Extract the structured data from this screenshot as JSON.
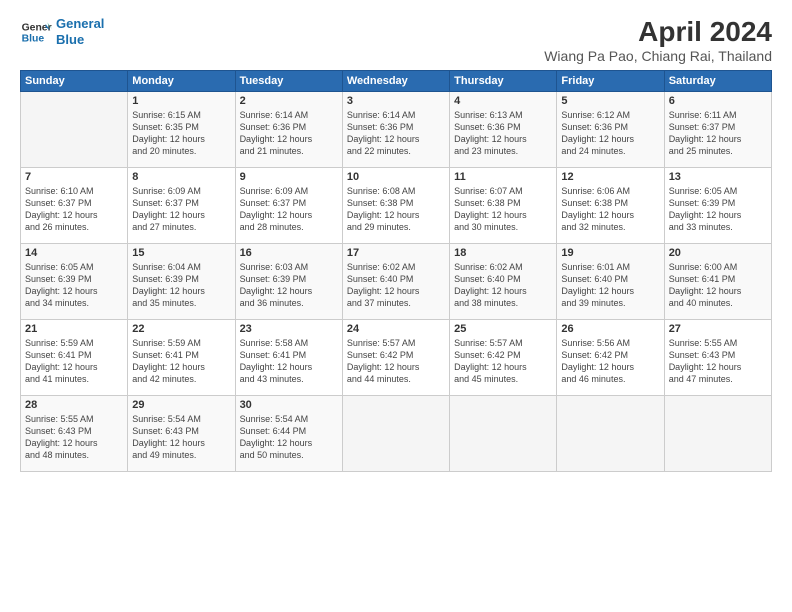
{
  "header": {
    "logo_line1": "General",
    "logo_line2": "Blue",
    "month": "April 2024",
    "location": "Wiang Pa Pao, Chiang Rai, Thailand"
  },
  "weekdays": [
    "Sunday",
    "Monday",
    "Tuesday",
    "Wednesday",
    "Thursday",
    "Friday",
    "Saturday"
  ],
  "weeks": [
    [
      {
        "day": "",
        "text": ""
      },
      {
        "day": "1",
        "text": "Sunrise: 6:15 AM\nSunset: 6:35 PM\nDaylight: 12 hours\nand 20 minutes."
      },
      {
        "day": "2",
        "text": "Sunrise: 6:14 AM\nSunset: 6:36 PM\nDaylight: 12 hours\nand 21 minutes."
      },
      {
        "day": "3",
        "text": "Sunrise: 6:14 AM\nSunset: 6:36 PM\nDaylight: 12 hours\nand 22 minutes."
      },
      {
        "day": "4",
        "text": "Sunrise: 6:13 AM\nSunset: 6:36 PM\nDaylight: 12 hours\nand 23 minutes."
      },
      {
        "day": "5",
        "text": "Sunrise: 6:12 AM\nSunset: 6:36 PM\nDaylight: 12 hours\nand 24 minutes."
      },
      {
        "day": "6",
        "text": "Sunrise: 6:11 AM\nSunset: 6:37 PM\nDaylight: 12 hours\nand 25 minutes."
      }
    ],
    [
      {
        "day": "7",
        "text": "Sunrise: 6:10 AM\nSunset: 6:37 PM\nDaylight: 12 hours\nand 26 minutes."
      },
      {
        "day": "8",
        "text": "Sunrise: 6:09 AM\nSunset: 6:37 PM\nDaylight: 12 hours\nand 27 minutes."
      },
      {
        "day": "9",
        "text": "Sunrise: 6:09 AM\nSunset: 6:37 PM\nDaylight: 12 hours\nand 28 minutes."
      },
      {
        "day": "10",
        "text": "Sunrise: 6:08 AM\nSunset: 6:38 PM\nDaylight: 12 hours\nand 29 minutes."
      },
      {
        "day": "11",
        "text": "Sunrise: 6:07 AM\nSunset: 6:38 PM\nDaylight: 12 hours\nand 30 minutes."
      },
      {
        "day": "12",
        "text": "Sunrise: 6:06 AM\nSunset: 6:38 PM\nDaylight: 12 hours\nand 32 minutes."
      },
      {
        "day": "13",
        "text": "Sunrise: 6:05 AM\nSunset: 6:39 PM\nDaylight: 12 hours\nand 33 minutes."
      }
    ],
    [
      {
        "day": "14",
        "text": "Sunrise: 6:05 AM\nSunset: 6:39 PM\nDaylight: 12 hours\nand 34 minutes."
      },
      {
        "day": "15",
        "text": "Sunrise: 6:04 AM\nSunset: 6:39 PM\nDaylight: 12 hours\nand 35 minutes."
      },
      {
        "day": "16",
        "text": "Sunrise: 6:03 AM\nSunset: 6:39 PM\nDaylight: 12 hours\nand 36 minutes."
      },
      {
        "day": "17",
        "text": "Sunrise: 6:02 AM\nSunset: 6:40 PM\nDaylight: 12 hours\nand 37 minutes."
      },
      {
        "day": "18",
        "text": "Sunrise: 6:02 AM\nSunset: 6:40 PM\nDaylight: 12 hours\nand 38 minutes."
      },
      {
        "day": "19",
        "text": "Sunrise: 6:01 AM\nSunset: 6:40 PM\nDaylight: 12 hours\nand 39 minutes."
      },
      {
        "day": "20",
        "text": "Sunrise: 6:00 AM\nSunset: 6:41 PM\nDaylight: 12 hours\nand 40 minutes."
      }
    ],
    [
      {
        "day": "21",
        "text": "Sunrise: 5:59 AM\nSunset: 6:41 PM\nDaylight: 12 hours\nand 41 minutes."
      },
      {
        "day": "22",
        "text": "Sunrise: 5:59 AM\nSunset: 6:41 PM\nDaylight: 12 hours\nand 42 minutes."
      },
      {
        "day": "23",
        "text": "Sunrise: 5:58 AM\nSunset: 6:41 PM\nDaylight: 12 hours\nand 43 minutes."
      },
      {
        "day": "24",
        "text": "Sunrise: 5:57 AM\nSunset: 6:42 PM\nDaylight: 12 hours\nand 44 minutes."
      },
      {
        "day": "25",
        "text": "Sunrise: 5:57 AM\nSunset: 6:42 PM\nDaylight: 12 hours\nand 45 minutes."
      },
      {
        "day": "26",
        "text": "Sunrise: 5:56 AM\nSunset: 6:42 PM\nDaylight: 12 hours\nand 46 minutes."
      },
      {
        "day": "27",
        "text": "Sunrise: 5:55 AM\nSunset: 6:43 PM\nDaylight: 12 hours\nand 47 minutes."
      }
    ],
    [
      {
        "day": "28",
        "text": "Sunrise: 5:55 AM\nSunset: 6:43 PM\nDaylight: 12 hours\nand 48 minutes."
      },
      {
        "day": "29",
        "text": "Sunrise: 5:54 AM\nSunset: 6:43 PM\nDaylight: 12 hours\nand 49 minutes."
      },
      {
        "day": "30",
        "text": "Sunrise: 5:54 AM\nSunset: 6:44 PM\nDaylight: 12 hours\nand 50 minutes."
      },
      {
        "day": "",
        "text": ""
      },
      {
        "day": "",
        "text": ""
      },
      {
        "day": "",
        "text": ""
      },
      {
        "day": "",
        "text": ""
      }
    ]
  ]
}
